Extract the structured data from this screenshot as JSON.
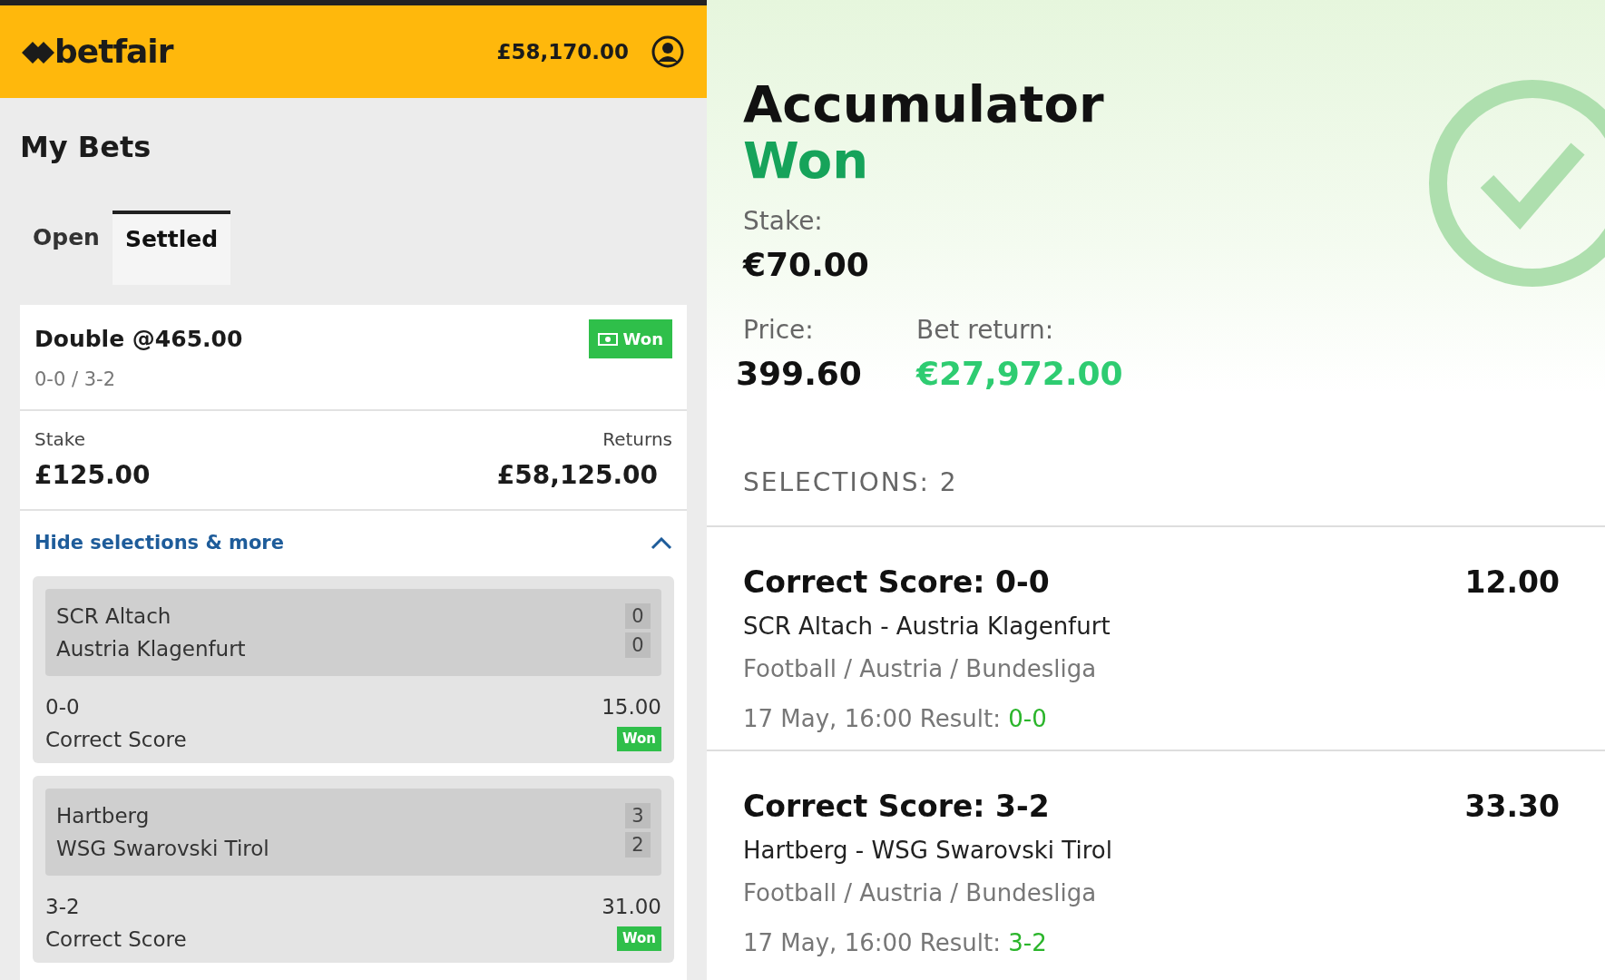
{
  "bet_slip": {
    "header": {
      "logo": "betfair",
      "balance": "£58,170.00"
    },
    "title": "My Bets",
    "tabs": [
      {
        "label": "Open",
        "selected": false
      },
      {
        "label": "Settled",
        "selected": true
      }
    ],
    "bet": {
      "title": "Double @465.00",
      "status": "Won",
      "scores": "0-0 / 3-2",
      "stake_label": "Stake",
      "stake": "£125.00",
      "returns_label": "Returns",
      "returns": "£58,125.00",
      "toggle": "Hide selections & more",
      "expanded": true,
      "selections": [
        {
          "home": "SCR Altach",
          "away": "Austria Klagenfurt",
          "home_score": "0",
          "away_score": "0",
          "pick": "0-0",
          "odds": "15.00",
          "market": "Correct Score",
          "status": "Won"
        },
        {
          "home": "Hartberg",
          "away": "WSG Swarovski Tirol",
          "home_score": "3",
          "away_score": "2",
          "pick": "3-2",
          "odds": "31.00",
          "market": "Correct Score",
          "status": "Won"
        }
      ]
    }
  },
  "receipt": {
    "title": "Accumulator",
    "status": "Won",
    "stake_label": "Stake:",
    "stake": "€70.00",
    "price_label": "Price:",
    "price": "399.60",
    "return_label": "Bet return:",
    "return": "€27,972.00",
    "selections_heading": "SELECTIONS: 2",
    "selections": [
      {
        "market": "Correct Score: 0-0",
        "odds": "12.00",
        "match": "SCR Altach - Austria Klagenfurt",
        "path": "Football / Austria / Bundesliga",
        "datetime": "17 May, 16:00",
        "result_label": "Result:",
        "result": "0-0"
      },
      {
        "market": "Correct Score: 3-2",
        "odds": "33.30",
        "match": "Hartberg - WSG Swarovski Tirol",
        "path": "Football / Austria / Bundesliga",
        "datetime": "17 May, 16:00",
        "result_label": "Result:",
        "result": "3-2"
      }
    ]
  }
}
